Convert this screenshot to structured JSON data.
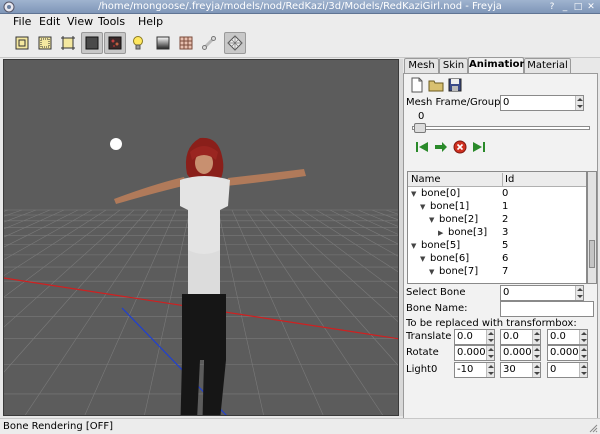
{
  "window": {
    "title": "/home/mongoose/.freyja/models/nod/RedKazi/3d/Models/RedKaziGirl.nod - Freyja"
  },
  "menu": {
    "items": [
      "File",
      "Edit",
      "View",
      "Tools",
      "Help"
    ]
  },
  "toolbar": {
    "icons": [
      "zoom-extent-icon",
      "select-icon",
      "crop-icon",
      "solid-view-icon",
      "texture-view-icon",
      "light-bulb-icon",
      "gradient-icon",
      "checker-icon",
      "bone-icon",
      "grid-icon"
    ],
    "active": [
      3,
      4,
      9
    ]
  },
  "viewport": {
    "background": "#5b5b5b",
    "grid_color": "#7a7a7a",
    "axis_x_color": "#d02020",
    "axis_z_color": "#2040d0"
  },
  "panel": {
    "tabs": [
      "Mesh",
      "Skin",
      "Animation",
      "Material"
    ],
    "active_tab": "Animation",
    "mesh_frame_group_label": "Mesh Frame/Group",
    "mesh_frame_group_value": "0",
    "frame_slider_value": "0",
    "tree_headers": [
      "Name",
      "Id"
    ],
    "bones": [
      {
        "name": "bone[0]",
        "id": "0",
        "expander": "▼"
      },
      {
        "name": "bone[1]",
        "id": "1",
        "expander": "▼"
      },
      {
        "name": "bone[2]",
        "id": "2",
        "expander": "▼"
      },
      {
        "name": "bone[3]",
        "id": "3",
        "expander": "▶"
      },
      {
        "name": "bone[5]",
        "id": "5",
        "expander": "▼"
      },
      {
        "name": "bone[6]",
        "id": "6",
        "expander": "▼"
      },
      {
        "name": "bone[7]",
        "id": "7",
        "expander": "▼"
      }
    ],
    "select_bone_label": "Select Bone",
    "select_bone_value": "0",
    "bone_name_label": "Bone Name:",
    "bone_name_value": "",
    "transform_note": "To be replaced with transformbox:",
    "translate_label": "Translate",
    "translate": [
      "0.0",
      "0.0",
      "0.0"
    ],
    "rotate_label": "Rotate",
    "rotate": [
      "0.000",
      "0.000",
      "0.000"
    ],
    "light_label": "Light0",
    "light": [
      "-10",
      "30",
      "0"
    ]
  },
  "status": {
    "text": "Bone Rendering [OFF]"
  }
}
